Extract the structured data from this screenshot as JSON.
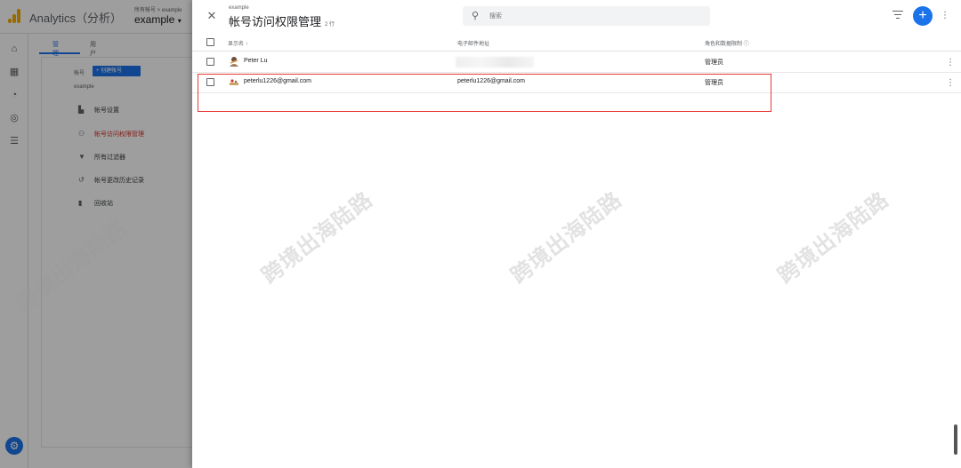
{
  "app": {
    "title": "Analytics（分析）",
    "account_crumb": "所有帐号 > example",
    "account_name": "example"
  },
  "admin": {
    "tabs": [
      "管理",
      "用户"
    ],
    "account_label": "帐号",
    "create_account_label": "+ 创建帐号",
    "account_sub": "example",
    "menu": [
      {
        "label": "帐号设置",
        "icon": "building-icon"
      },
      {
        "label": "帐号访问权限管理",
        "icon": "people-icon"
      },
      {
        "label": "所有过滤器",
        "icon": "filter-icon"
      },
      {
        "label": "帐号更改历史记录",
        "icon": "history-icon"
      },
      {
        "label": "回收站",
        "icon": "trash-icon"
      }
    ]
  },
  "panel": {
    "subtitle": "example",
    "title": "帐号访问权限管理",
    "row_count": "2 行",
    "search_placeholder": "搜索",
    "columns": {
      "name": "显示名 ↑",
      "email": "电子邮件地址",
      "role": "角色和数据限制 ⓘ"
    },
    "rows": [
      {
        "name": "Peter Lu",
        "email": "",
        "role": "管理员"
      },
      {
        "name": "peterlu1226@gmail.com",
        "email": "peterlu1226@gmail.com",
        "role": "管理员"
      }
    ]
  },
  "watermark": "跨境出海陆路",
  "colors": {
    "accent": "#1a73e8",
    "highlight": "#e53935",
    "selected_menu": "#d93025",
    "logo": "#f9ab00"
  }
}
